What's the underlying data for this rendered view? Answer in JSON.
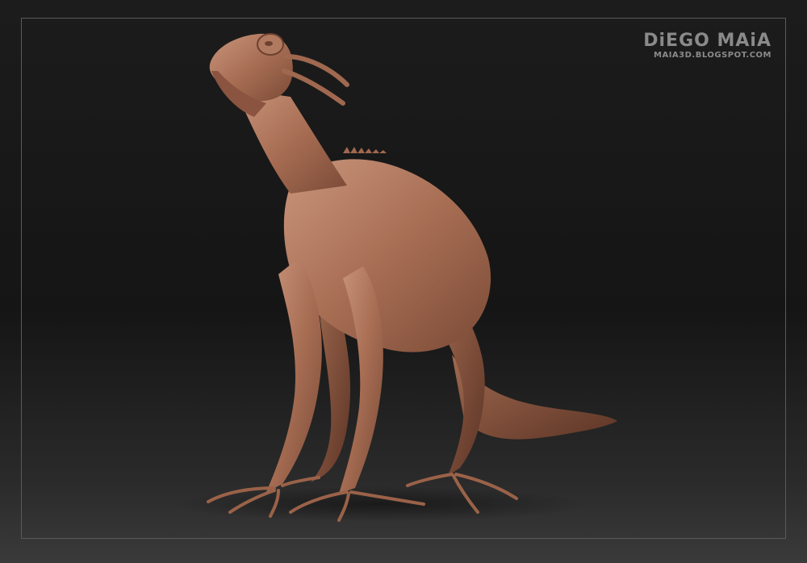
{
  "watermark": {
    "name": "DiEGO MAiA",
    "site": "MAIA3D.BLOGSPOT.COM"
  },
  "colors": {
    "background": "#1a1a1a",
    "frame": "#5a5a5a",
    "skin_light": "#c08a72",
    "skin_mid": "#a0684f",
    "skin_dark": "#6e4030",
    "watermark": "#8a8a8a"
  }
}
